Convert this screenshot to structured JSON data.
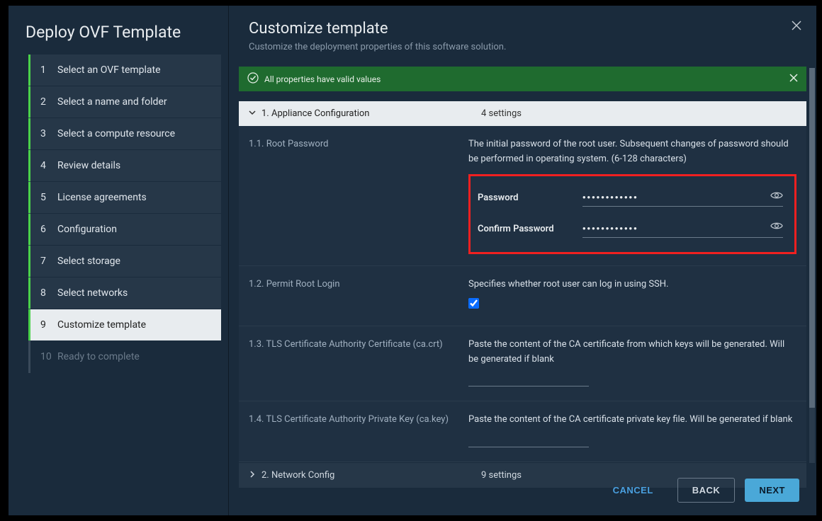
{
  "wizard_title": "Deploy OVF Template",
  "steps": [
    {
      "num": "1",
      "label": "Select an OVF template",
      "state": "completed"
    },
    {
      "num": "2",
      "label": "Select a name and folder",
      "state": "completed"
    },
    {
      "num": "3",
      "label": "Select a compute resource",
      "state": "completed"
    },
    {
      "num": "4",
      "label": "Review details",
      "state": "completed"
    },
    {
      "num": "5",
      "label": "License agreements",
      "state": "completed"
    },
    {
      "num": "6",
      "label": "Configuration",
      "state": "completed"
    },
    {
      "num": "7",
      "label": "Select storage",
      "state": "completed"
    },
    {
      "num": "8",
      "label": "Select networks",
      "state": "completed"
    },
    {
      "num": "9",
      "label": "Customize template",
      "state": "active"
    },
    {
      "num": "10",
      "label": "Ready to complete",
      "state": "disabled"
    }
  ],
  "content": {
    "title": "Customize template",
    "subtitle": "Customize the deployment properties of this software solution."
  },
  "banner": {
    "text": "All properties have valid values"
  },
  "section1": {
    "header": "1. Appliance Configuration",
    "meta": "4 settings",
    "p1": {
      "label": "1.1. Root Password",
      "desc": "The initial password of the root user. Subsequent changes of password should be performed in operating system. (6-128 characters)",
      "pw_label": "Password",
      "cpw_label": "Confirm Password",
      "pw_value": "••••••••••••",
      "cpw_value": "••••••••••••"
    },
    "p2": {
      "label": "1.2. Permit Root Login",
      "desc": "Specifies whether root user can log in using SSH."
    },
    "p3": {
      "label": "1.3. TLS Certificate Authority Certificate (ca.crt)",
      "desc": "Paste the content of the CA certificate from which keys will be generated. Will be generated if blank"
    },
    "p4": {
      "label": "1.4. TLS Certificate Authority Private Key (ca.key)",
      "desc": "Paste the content of the CA certificate private key file. Will be generated if blank"
    }
  },
  "section2": {
    "header": "2. Network Config",
    "meta": "9 settings"
  },
  "buttons": {
    "cancel": "CANCEL",
    "back": "BACK",
    "next": "NEXT"
  }
}
